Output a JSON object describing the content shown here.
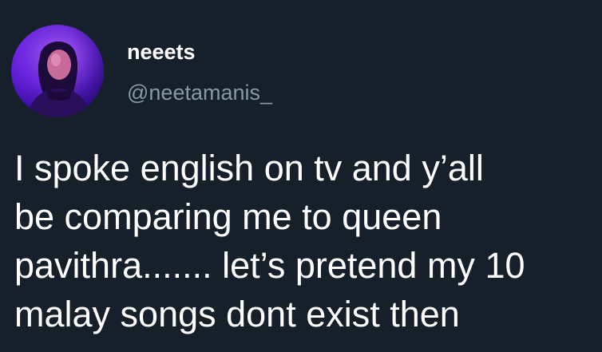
{
  "tweet": {
    "display_name": "neeets",
    "handle": "@neetamanis_",
    "avatar_icon": "profile-photo",
    "text_lines": [
      "I spoke english on tv and y’all",
      "be comparing me to queen",
      "pavithra....... let’s pretend my 10",
      "malay songs dont exist then"
    ]
  },
  "colors": {
    "background": "#15202b",
    "text": "#ffffff",
    "secondary_text": "#8899a6"
  }
}
